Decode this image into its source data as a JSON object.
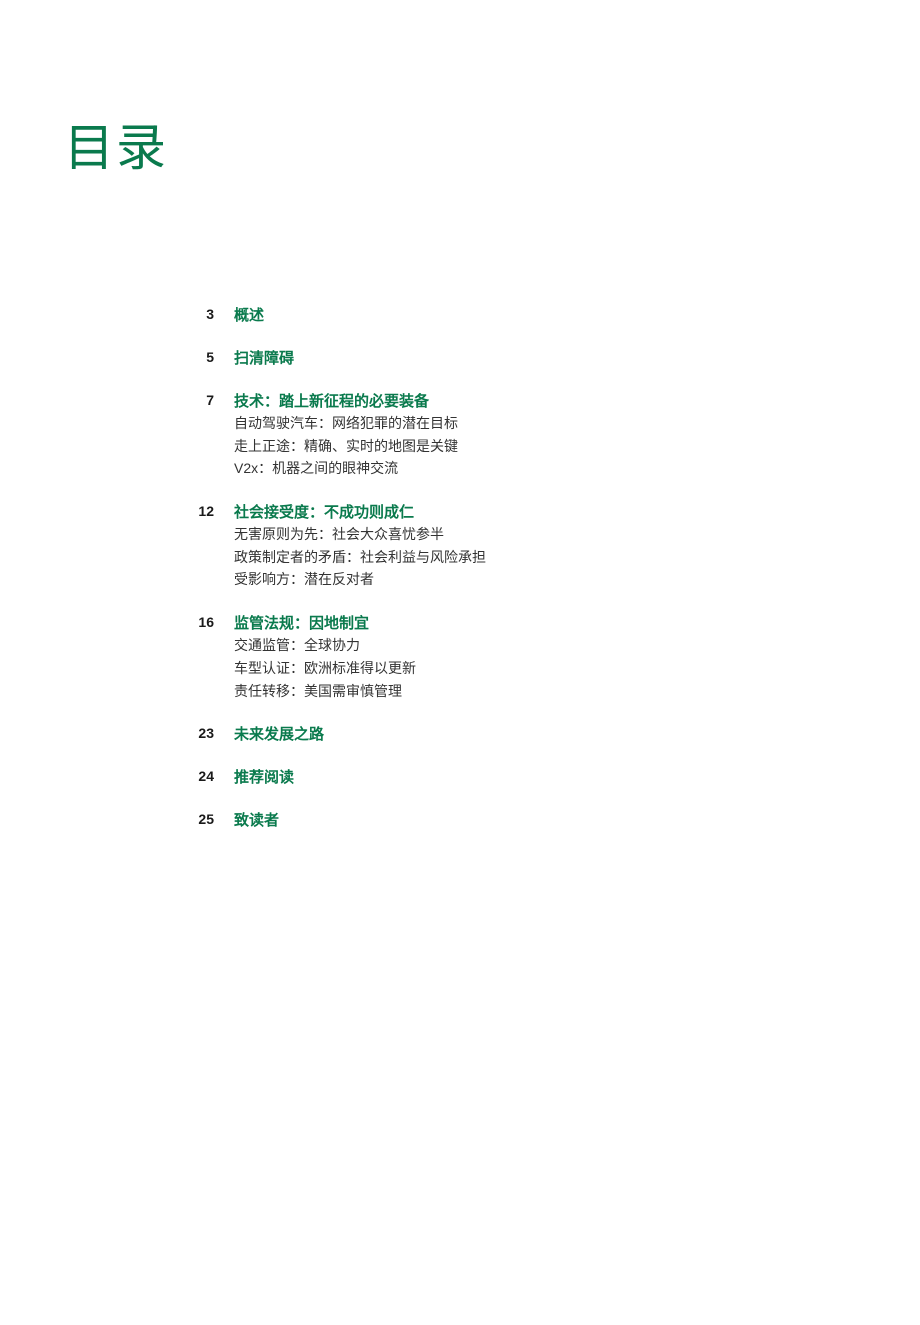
{
  "title": "目录",
  "toc": [
    {
      "page": "3",
      "heading": "概述",
      "subitems": []
    },
    {
      "page": "5",
      "heading": "扫清障碍",
      "subitems": []
    },
    {
      "page": "7",
      "heading": "技术：踏上新征程的必要装备",
      "subitems": [
        "自动驾驶汽车：网络犯罪的潜在目标",
        "走上正途：精确、实时的地图是关键",
        "V2x：机器之间的眼神交流"
      ]
    },
    {
      "page": "12",
      "heading": "社会接受度：不成功则成仁",
      "subitems": [
        "无害原则为先：社会大众喜忧参半",
        "政策制定者的矛盾：社会利益与风险承担",
        "受影响方：潜在反对者"
      ]
    },
    {
      "page": "16",
      "heading": "监管法规：因地制宜",
      "subitems": [
        "交通监管：全球协力",
        "车型认证：欧洲标准得以更新",
        "责任转移：美国需审慎管理"
      ]
    },
    {
      "page": "23",
      "heading": "未来发展之路",
      "subitems": []
    },
    {
      "page": "24",
      "heading": "推荐阅读",
      "subitems": []
    },
    {
      "page": "25",
      "heading": "致读者",
      "subitems": []
    }
  ]
}
